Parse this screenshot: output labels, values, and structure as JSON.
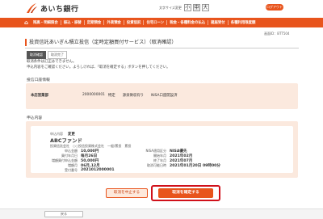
{
  "header": {
    "bank_name": "あいち銀行",
    "font_size_label": "文字サイズ変更",
    "font_sizes": [
      "小",
      "中",
      "大"
    ],
    "active_font_size": "中",
    "logout_label": "ログアウト",
    "brand_color": "#e8541c"
  },
  "nav": {
    "items": [
      "⌂",
      "残高・明細照会",
      "振込・振替",
      "定期預金",
      "外貨預金",
      "投資信託",
      "住宅ローン",
      "税金・各種料金の払込",
      "諸届受付",
      "各種利用限度額"
    ]
  },
  "page": {
    "screen_id": "画面ID：BTT504",
    "title": "投資信託あいぎん積立投信（定時定額買付サービス）（取消確認）",
    "steps": [
      "取消確認",
      "取消完了"
    ],
    "active_step": "取消確認",
    "message_line1": "取消条件は訂正はできません。",
    "message_line2": "申込内容をご確認ください。よろしければ、「取消を確定する」ボタンを押してください。"
  },
  "account": {
    "section_label": "投信口座情報",
    "branch": "本店営業部",
    "account_number": "2000000001",
    "tokutei": "特定",
    "withholding": "源泉徴収有り",
    "nisa": "NISA口座開設済"
  },
  "application": {
    "section_label": "申込内容",
    "type_label": "申込内容",
    "type_value": "変更",
    "fund_name": "ABCファンド",
    "management_company": "投資信託会社　○○投信投資株式会社　一般/累投　累投",
    "left_fields": [
      {
        "key": "申込金額",
        "value": "10,000円"
      },
      {
        "key": "買付年月日",
        "value": "毎月26日"
      },
      {
        "key": "増額買付申込金額",
        "value": "50,000円"
      },
      {
        "key": "増額月",
        "value": "06月,12月"
      },
      {
        "key": "受付番号",
        "value": "2021012000001"
      }
    ],
    "right_fields": [
      {
        "key": "NISA適用区分",
        "value": "NISA優先"
      },
      {
        "key": "開始年月",
        "value": "2021年02月"
      },
      {
        "key": "終了年月",
        "value": "2021年07月"
      },
      {
        "key": "取消可能日時",
        "value": "2021年01月20日 09時00分"
      }
    ]
  },
  "buttons": {
    "cancel_label": "取消を中止する",
    "confirm_label": "取消を確定する",
    "back_label": "戻る"
  }
}
